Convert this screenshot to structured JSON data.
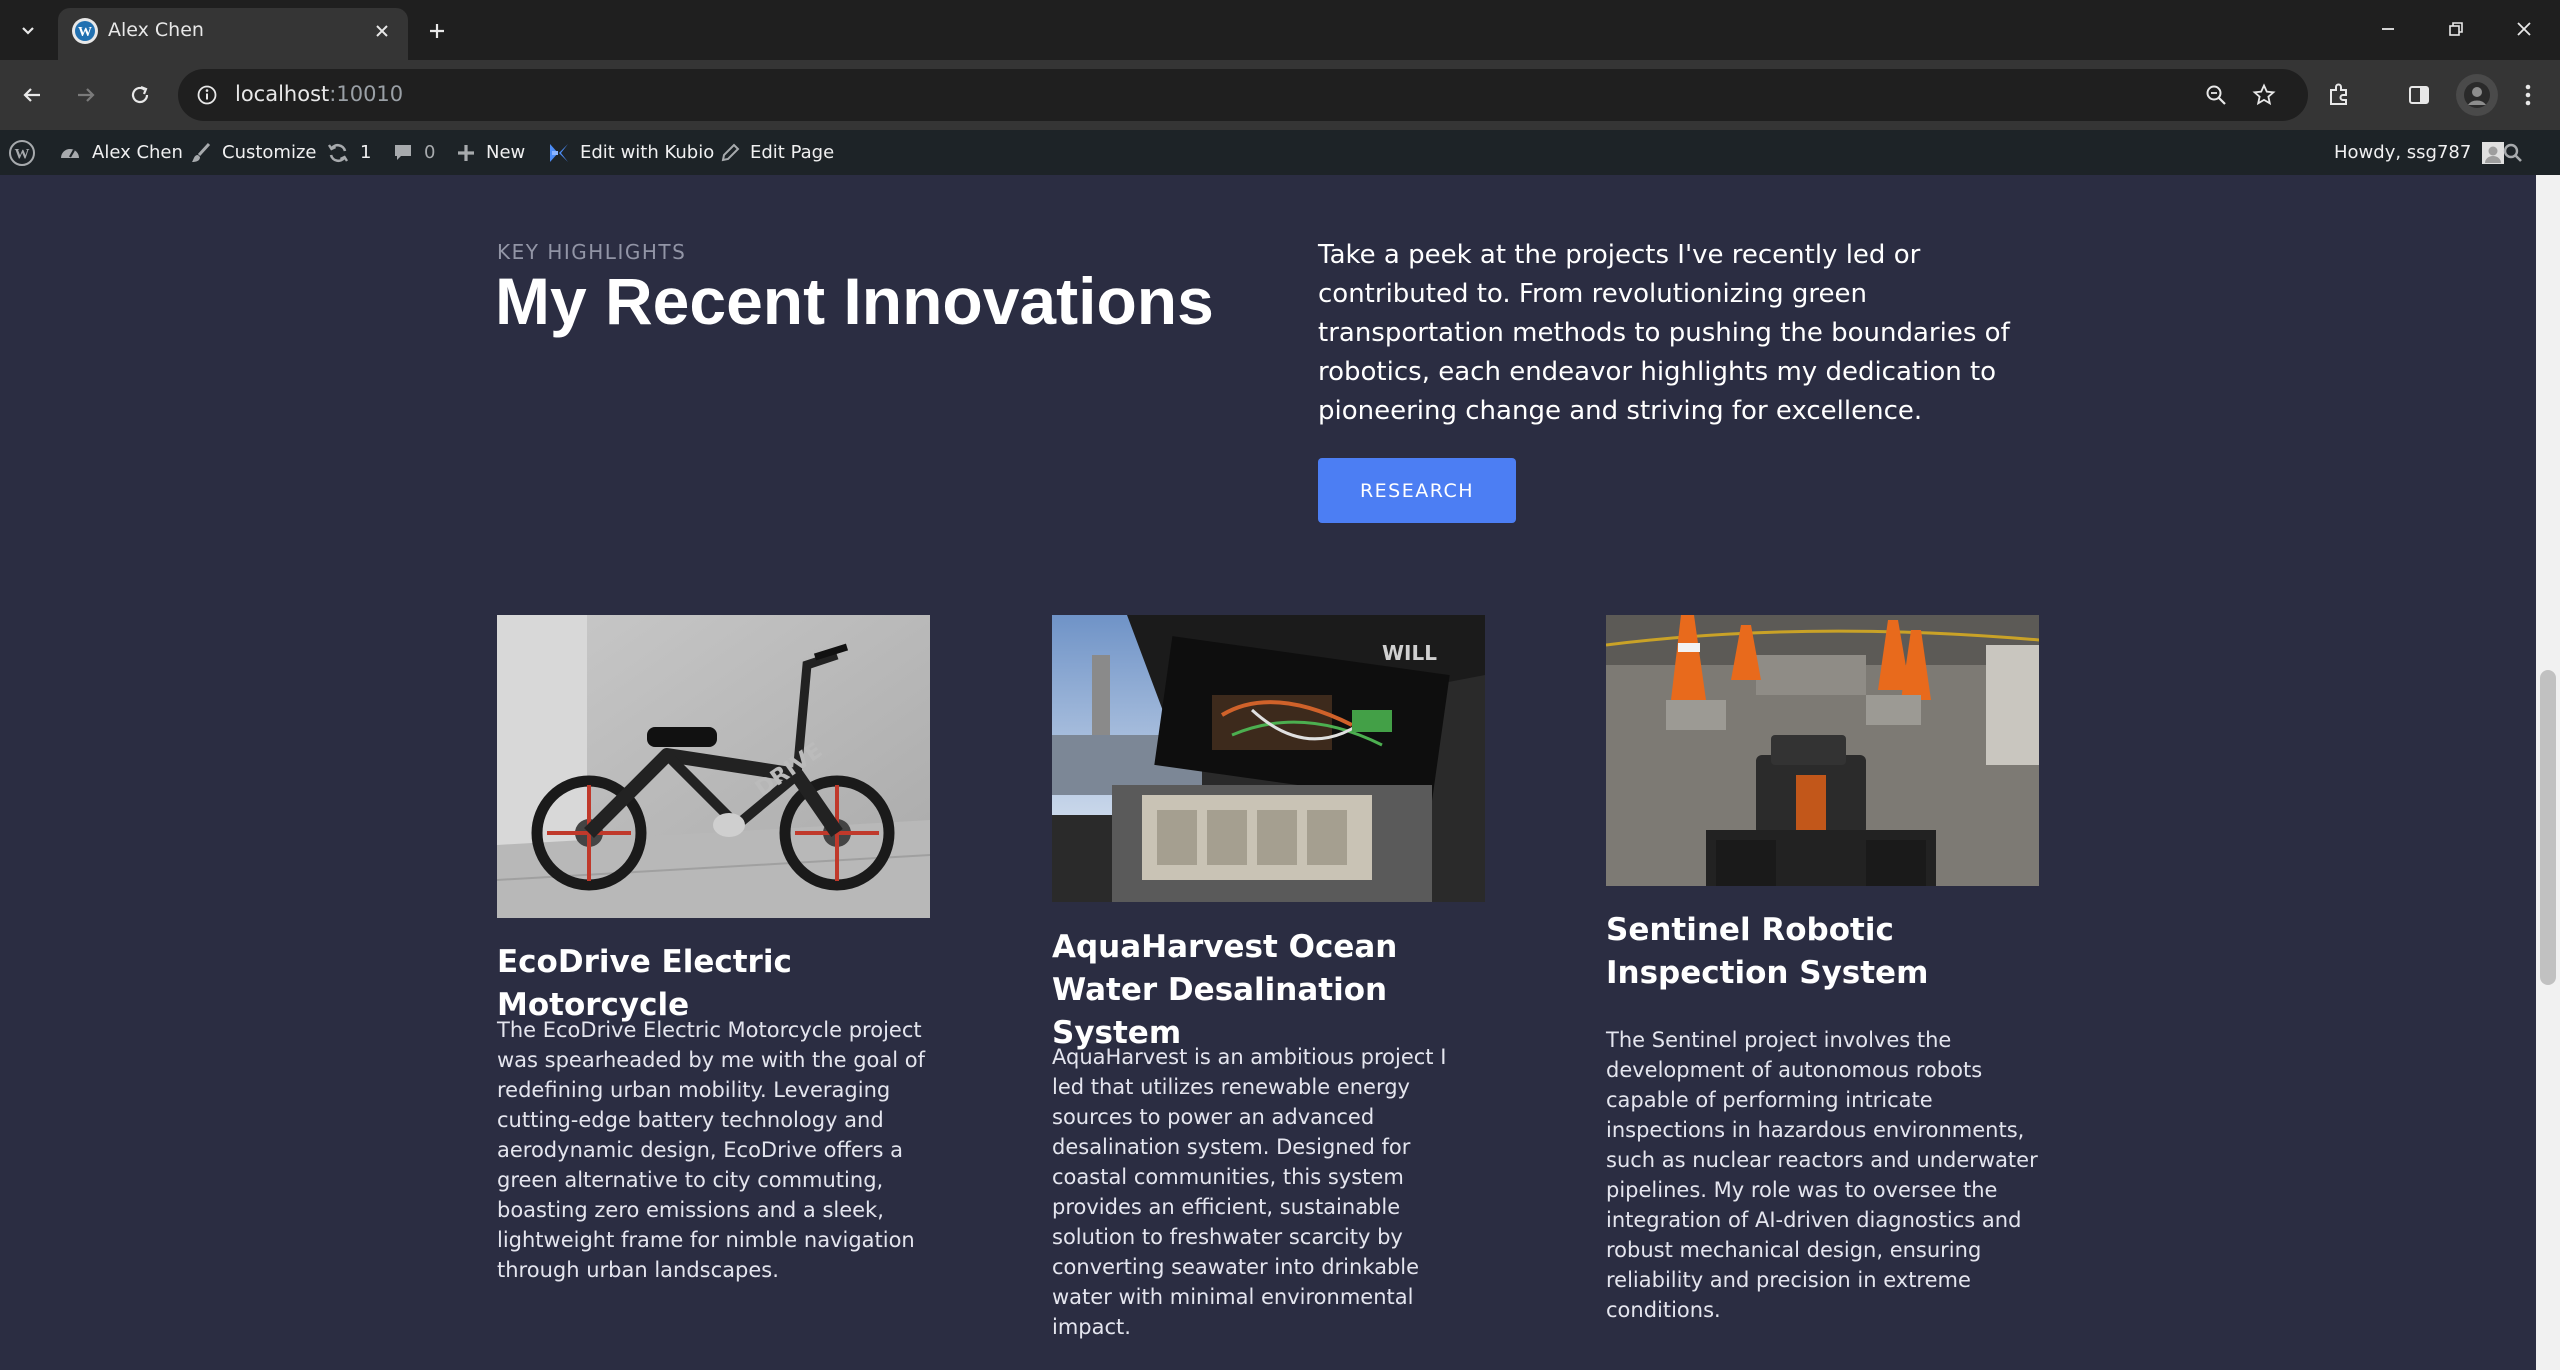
{
  "browser": {
    "tab_title": "Alex Chen",
    "url_host": "localhost",
    "url_port": ":10010"
  },
  "admin_bar": {
    "site_name": "Alex Chen",
    "customize": "Customize",
    "updates_count": "1",
    "comments_count": "0",
    "new_label": "New",
    "kubio_label": "Edit with Kubio",
    "edit_page_label": "Edit Page",
    "howdy": "Howdy, ssg787"
  },
  "hero": {
    "eyebrow": "KEY HIGHLIGHTS",
    "headline": "My Recent Innovations",
    "intro": "Take a peek at the projects I've recently led or contributed to. From revolutionizing green transportation methods to pushing the boundaries of robotics, each endeavor highlights my dedication to pioneering change and striving for excellence.",
    "cta_label": "RESEARCH"
  },
  "projects": [
    {
      "title": "EcoDrive Electric Motorcycle",
      "description": "The EcoDrive Electric Motorcycle project was spearheaded by me with the goal of redefining urban mobility. Leveraging cutting-edge battery technology and aerodynamic design, EcoDrive offers a green alternative to city commuting, boasting zero emissions and a sleek, lightweight frame for nimble navigation through urban landscapes."
    },
    {
      "title": "AquaHarvest Ocean Water Desalination System",
      "description": "AquaHarvest is an ambitious project I led that utilizes renewable energy sources to power an advanced desalination system. Designed for coastal communities, this system provides an efficient, sustainable solution to freshwater scarcity by converting seawater into drinkable water with minimal environmental impact."
    },
    {
      "title": "Sentinel Robotic Inspection System",
      "description": "The Sentinel project involves the development of autonomous robots capable of performing intricate inspections in hazardous environments, such as nuclear reactors and underwater pipelines. My role was to oversee the integration of AI-driven diagnostics and robust mechanical design, ensuring reliability and precision in extreme conditions."
    }
  ],
  "colors": {
    "page_bg": "#2b2d42",
    "accent": "#4c7ef3",
    "admin_bar": "#1d2327"
  }
}
